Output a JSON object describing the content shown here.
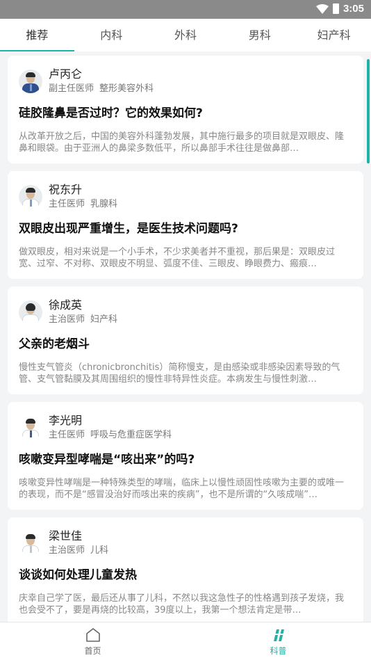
{
  "status_bar": {
    "time": "3:05"
  },
  "tabs": [
    {
      "label": "推荐"
    },
    {
      "label": "内科"
    },
    {
      "label": "外科"
    },
    {
      "label": "男科"
    },
    {
      "label": "妇产科"
    }
  ],
  "articles": [
    {
      "doctor_name": "卢丙仑",
      "doctor_title": "副主任医师",
      "department": "整形美容外科",
      "title": "硅胶隆鼻是否过时？它的效果如何?",
      "excerpt": "从改革开放之后，中国的美容外科蓬勃发展，其中施行最多的项目就是双眼皮、隆鼻和眼袋。由于亚洲人的鼻梁多数低平，所以鼻部手术往往是做鼻部…"
    },
    {
      "doctor_name": "祝东升",
      "doctor_title": "主任医师",
      "department": "乳腺科",
      "title": "双眼皮出现严重增生，是医生技术问题吗?",
      "excerpt": "做双眼皮，相对来说是一个小手术，不少求美者并不重视，那后果是：双眼皮过宽、过窄、不对称、双眼皮不明显、弧度不佳、三眼皮、睁眼费力、瘢痕…"
    },
    {
      "doctor_name": "徐成英",
      "doctor_title": "主治医师",
      "department": "妇产科",
      "title": "父亲的老烟斗",
      "excerpt": "慢性支气管炎（chronicbronchitis）简称慢支，是由感染或非感染因素导致的气管、支气管黏膜及其周围组织的慢性非特异性炎症。本病发生与慢性刺激…"
    },
    {
      "doctor_name": "李光明",
      "doctor_title": "主任医师",
      "department": "呼吸与危重症医学科",
      "title": "咳嗽变异型哮喘是“咳出来”的吗?",
      "excerpt": "咳嗽变异性哮喘是一种特殊类型的哮喘，临床上以慢性顽固性咳嗽为主要的或唯一的表现，而不是“感冒没治好而咳出来的疾病”，也不是所谓的“久咳成喘”…"
    },
    {
      "doctor_name": "梁世佳",
      "doctor_title": "主治医师",
      "department": "儿科",
      "title": "谈谈如何处理儿童发热",
      "excerpt": "庆幸自己学了医，最后还从事了儿科，不然以我这急性子的性格遇到孩子发烧，我也会受不了，要是再烧的比较高，39度以上，我第一个想法肯定是带…"
    }
  ],
  "bottom_nav": [
    {
      "label": "首页",
      "icon": "home-icon"
    },
    {
      "label": "科普",
      "icon": "science-icon"
    }
  ],
  "colors": {
    "accent": "#1fb3a7",
    "status_bar": "#8a8a8a"
  }
}
